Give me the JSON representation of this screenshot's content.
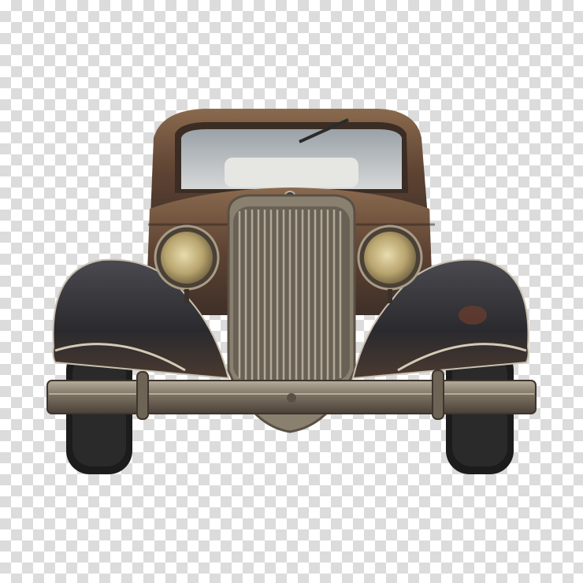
{
  "image": {
    "background": "transparency-checkerboard",
    "subject": "vintage-car-front-view",
    "colors": {
      "checker_light": "#ffffff",
      "checker_dark": "#dcdcdc",
      "body_rust": "#6e4a33",
      "fender_dark": "#2f2f33",
      "chrome": "#9a8f80",
      "headlight_glass": "#c9b98a",
      "tire": "#1b1b1b",
      "windshield": "#c8ccd0"
    }
  }
}
